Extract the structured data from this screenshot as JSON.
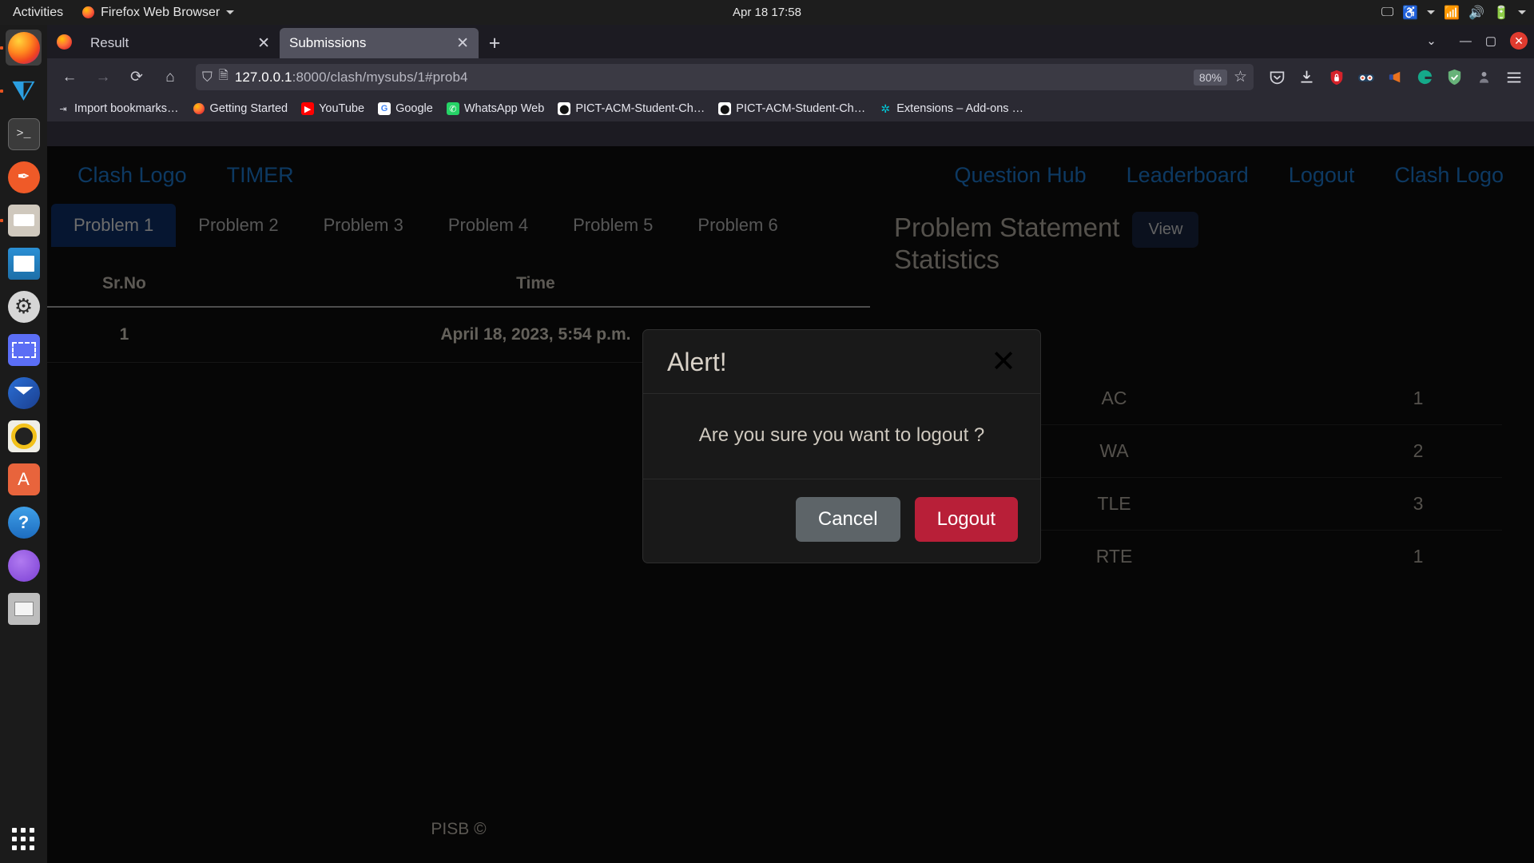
{
  "system_bar": {
    "activities": "Activities",
    "app_menu": "Firefox Web Browser",
    "clock": "Apr 18  17:58",
    "tray_icons": [
      "screencast-icon",
      "accessibility-icon",
      "network-icon",
      "volume-icon",
      "battery-icon",
      "power-menu-icon"
    ]
  },
  "dock": {
    "items": [
      {
        "name": "firefox",
        "icon": "firefox-icon",
        "running": true,
        "active": true
      },
      {
        "name": "vscode",
        "icon": "vscode-icon",
        "running": true,
        "active": false
      },
      {
        "name": "terminal",
        "icon": "terminal-icon",
        "running": false,
        "active": false
      },
      {
        "name": "inkscape",
        "icon": "inkscape-icon",
        "running": false,
        "active": false
      },
      {
        "name": "files",
        "icon": "files-icon",
        "running": true,
        "active": false
      },
      {
        "name": "writer",
        "icon": "document-icon",
        "running": false,
        "active": false
      },
      {
        "name": "settings",
        "icon": "gear-icon",
        "running": false,
        "active": false
      },
      {
        "name": "screenshot",
        "icon": "screenshot-icon",
        "running": false,
        "active": false
      },
      {
        "name": "thunderbird",
        "icon": "mail-icon",
        "running": false,
        "active": false
      },
      {
        "name": "media-player",
        "icon": "media-icon",
        "running": false,
        "active": false
      },
      {
        "name": "software",
        "icon": "ubuntu-software-icon",
        "running": false,
        "active": false
      },
      {
        "name": "help",
        "icon": "help-icon",
        "running": false,
        "active": false
      },
      {
        "name": "network-app",
        "icon": "network-graph-icon",
        "running": false,
        "active": false
      },
      {
        "name": "clipboard",
        "icon": "clipboard-icon",
        "running": false,
        "active": false
      }
    ],
    "show_apps_label": "Show Applications"
  },
  "browser": {
    "tabs": [
      {
        "title": "Result",
        "active": false
      },
      {
        "title": "Submissions",
        "active": true
      }
    ],
    "new_tab_label": "+",
    "window_controls": {
      "list_all_tabs": "⌄",
      "minimize": "—",
      "maximize": "▢",
      "close": "✕"
    },
    "nav": {
      "back": "←",
      "forward": "→",
      "reload": "⟳",
      "home": "⌂"
    },
    "url": {
      "host": "127.0.0.1",
      "rest": ":8000/clash/mysubs/1#prob4",
      "full": "127.0.0.1:8000/clash/mysubs/1#prob4",
      "shield_icon": "shield-icon",
      "page_icon": "page-icon"
    },
    "zoom_level": "80%",
    "bookmark_star": "☆",
    "toolbar_extensions": [
      {
        "name": "pocket-icon",
        "glyph": "♡"
      },
      {
        "name": "download-icon",
        "glyph": "⭳"
      },
      {
        "name": "red-shield-lock-icon",
        "glyph": "🔒"
      },
      {
        "name": "goggles-icon",
        "glyph": "👓"
      },
      {
        "name": "megaphone-icon",
        "glyph": "📣"
      },
      {
        "name": "grammarly-icon",
        "glyph": "G"
      },
      {
        "name": "adguard-shield-icon",
        "glyph": "✓"
      },
      {
        "name": "account-icon",
        "glyph": "👤"
      },
      {
        "name": "menu-icon",
        "glyph": "☰"
      }
    ],
    "bookmarks": [
      {
        "label": "Import bookmarks…",
        "icon": "import-icon",
        "color": "#dcdce4"
      },
      {
        "label": "Getting Started",
        "icon": "firefox-icon",
        "color": "#ff7139"
      },
      {
        "label": "YouTube",
        "icon": "youtube-icon",
        "color": "#ff0000"
      },
      {
        "label": "Google",
        "icon": "google-icon",
        "color": "#ffffff"
      },
      {
        "label": "WhatsApp Web",
        "icon": "whatsapp-icon",
        "color": "#25d366"
      },
      {
        "label": "PICT-ACM-Student-Ch…",
        "icon": "github-icon",
        "color": "#ffffff"
      },
      {
        "label": "PICT-ACM-Student-Ch…",
        "icon": "github-icon",
        "color": "#ffffff"
      },
      {
        "label": "Extensions – Add-ons …",
        "icon": "addons-icon",
        "color": "#00c8d7"
      }
    ]
  },
  "site": {
    "navbar": {
      "brand": "Clash Logo",
      "timer": "TIMER",
      "links": [
        "Question Hub",
        "Leaderboard",
        "Logout",
        "Clash Logo"
      ]
    },
    "problem_tabs": [
      {
        "label": "Problem 1",
        "active": true
      },
      {
        "label": "Problem 2",
        "active": false
      },
      {
        "label": "Problem 3",
        "active": false
      },
      {
        "label": "Problem 4",
        "active": false
      },
      {
        "label": "Problem 5",
        "active": false
      },
      {
        "label": "Problem 6",
        "active": false
      }
    ],
    "submissions_table": {
      "headers": [
        "Sr.No",
        "Time"
      ],
      "rows": [
        [
          "1",
          "April 18, 2023, 5:54 p.m."
        ]
      ]
    },
    "right_panel": {
      "problem_statement_title": "Problem Statement",
      "view_button": "View",
      "statistics_title": "Statistics",
      "stats": [
        {
          "key": "AC",
          "value": "1"
        },
        {
          "key": "WA",
          "value": "2"
        },
        {
          "key": "TLE",
          "value": "3"
        },
        {
          "key": "RTE",
          "value": "1"
        }
      ]
    },
    "footer": "PISB ©"
  },
  "modal": {
    "title": "Alert!",
    "close_icon": "close-icon",
    "message": "Are you sure you want to logout ?",
    "cancel_label": "Cancel",
    "logout_label": "Logout"
  },
  "colors": {
    "link_blue": "#1b72c4",
    "active_tab_navy": "#0c2d63",
    "logout_red": "#b81f38",
    "cancel_gray": "#5d6468",
    "page_bg": "#0c0c0c"
  }
}
